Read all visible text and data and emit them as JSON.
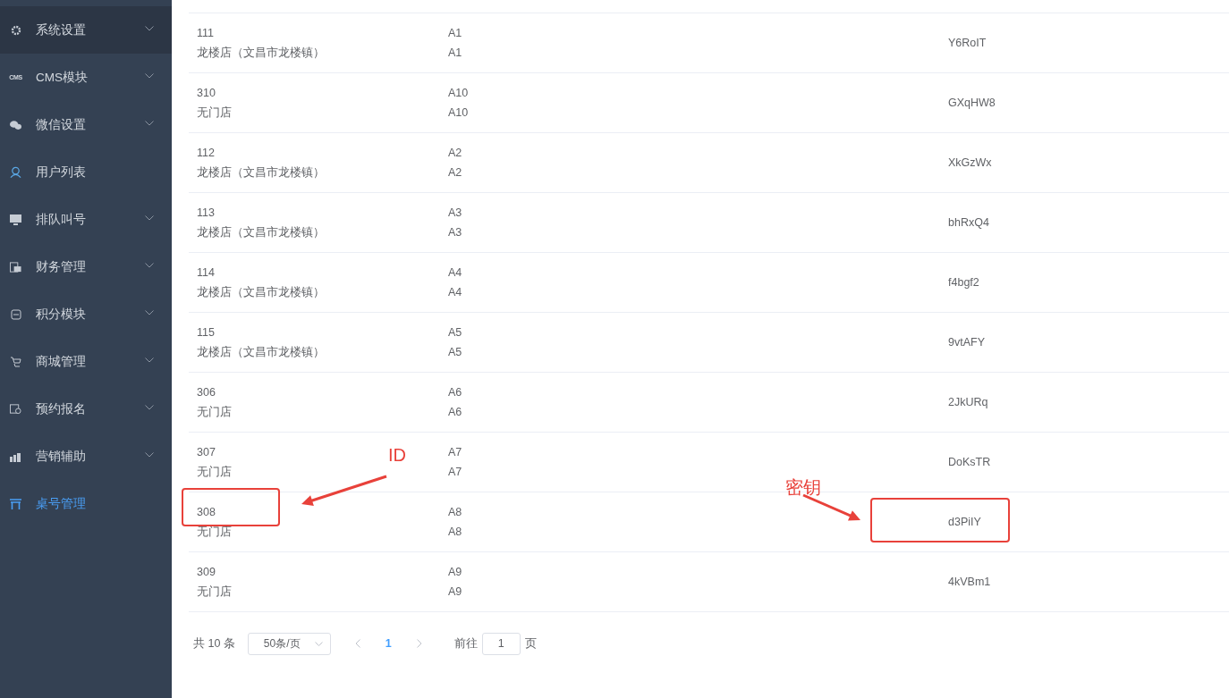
{
  "sidebar": {
    "items": [
      {
        "label": "系统设置",
        "expandable": true,
        "selected": false,
        "hovered": true
      },
      {
        "label": "CMS模块",
        "icon_text": "CMS",
        "expandable": true,
        "selected": false,
        "hovered": false
      },
      {
        "label": "微信设置",
        "expandable": true,
        "selected": false,
        "hovered": false
      },
      {
        "label": "用户列表",
        "expandable": false,
        "selected": false,
        "hovered": false
      },
      {
        "label": "排队叫号",
        "expandable": true,
        "selected": false,
        "hovered": false
      },
      {
        "label": "财务管理",
        "expandable": true,
        "selected": false,
        "hovered": false
      },
      {
        "label": "积分模块",
        "expandable": true,
        "selected": false,
        "hovered": false
      },
      {
        "label": "商城管理",
        "expandable": true,
        "selected": false,
        "hovered": false
      },
      {
        "label": "预约报名",
        "expandable": true,
        "selected": false,
        "hovered": false
      },
      {
        "label": "营销辅助",
        "expandable": true,
        "selected": false,
        "hovered": false
      },
      {
        "label": "桌号管理",
        "expandable": false,
        "selected": true,
        "hovered": false
      }
    ]
  },
  "table": {
    "rows": [
      {
        "id": "111",
        "store": "龙楼店（文昌市龙楼镇）",
        "table_name": "A1",
        "table_code": "A1",
        "key": "Y6RoIT"
      },
      {
        "id": "310",
        "store": "无门店",
        "table_name": "A10",
        "table_code": "A10",
        "key": "GXqHW8"
      },
      {
        "id": "112",
        "store": "龙楼店（文昌市龙楼镇）",
        "table_name": "A2",
        "table_code": "A2",
        "key": "XkGzWx"
      },
      {
        "id": "113",
        "store": "龙楼店（文昌市龙楼镇）",
        "table_name": "A3",
        "table_code": "A3",
        "key": "bhRxQ4"
      },
      {
        "id": "114",
        "store": "龙楼店（文昌市龙楼镇）",
        "table_name": "A4",
        "table_code": "A4",
        "key": "f4bgf2"
      },
      {
        "id": "115",
        "store": "龙楼店（文昌市龙楼镇）",
        "table_name": "A5",
        "table_code": "A5",
        "key": "9vtAFY"
      },
      {
        "id": "306",
        "store": "无门店",
        "table_name": "A6",
        "table_code": "A6",
        "key": "2JkURq"
      },
      {
        "id": "307",
        "store": "无门店",
        "table_name": "A7",
        "table_code": "A7",
        "key": "DoKsTR"
      },
      {
        "id": "308",
        "store": "无门店",
        "table_name": "A8",
        "table_code": "A8",
        "key": "d3PiIY"
      },
      {
        "id": "309",
        "store": "无门店",
        "table_name": "A9",
        "table_code": "A9",
        "key": "4kVBm1"
      }
    ]
  },
  "pagination": {
    "total": "共 10 条",
    "page_size": "50条/页",
    "pages": [
      {
        "label": "1",
        "selected": true
      }
    ],
    "goto_label": "前往",
    "goto_value": "1",
    "goto_suffix": "页"
  },
  "annotations": {
    "id_label": "ID",
    "key_label": "密钥"
  }
}
